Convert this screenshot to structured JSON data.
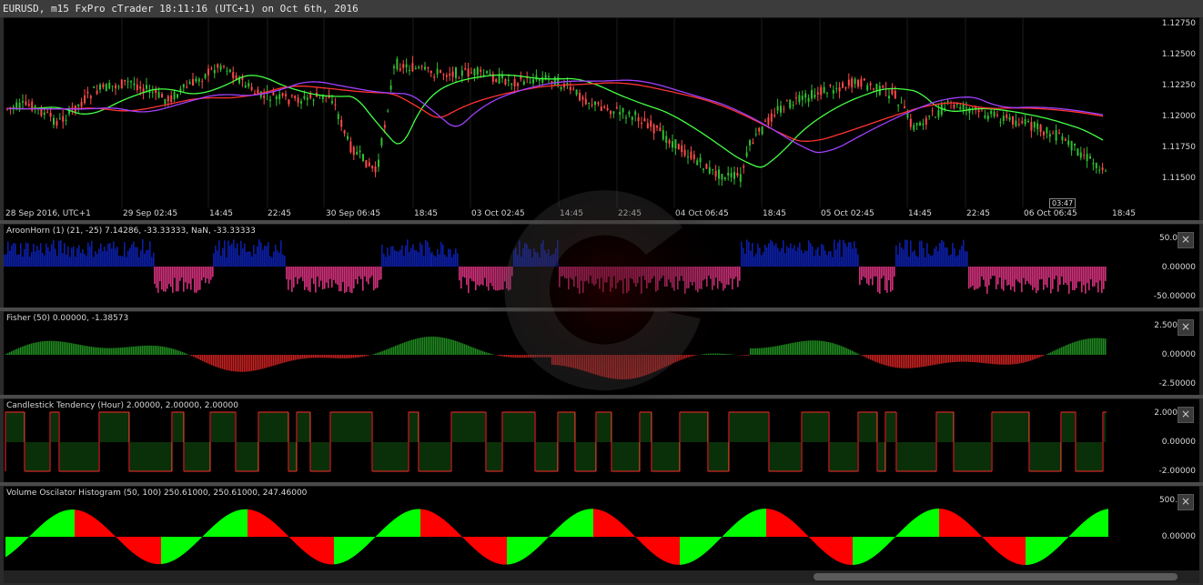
{
  "window": {
    "title": "EURUSD, m15 FxPro cTrader 18:11:16 (UTC+1) on Oct 6th, 2016"
  },
  "colors": {
    "bull": "#2fbf2f",
    "bear": "#ff4a4a",
    "blue_fill": "#0c1ea8",
    "pink_fill": "#d0307a",
    "fisher_green": "#1f8a1f",
    "fisher_red": "#c82020",
    "cst_green": "#1a7a1a",
    "cst_red": "#ff2a2a",
    "vo_green": "#00ff00",
    "vo_red": "#ff0000",
    "ma_green": "#44ff44",
    "ma_red": "#ff3333",
    "ma_purple": "#a040ff"
  },
  "price_pane": {
    "y_ticks": [
      "1.12750",
      "1.12500",
      "1.12250",
      "1.12000",
      "1.11750",
      "1.11500"
    ],
    "x_ticks": [
      "28 Sep 2016, UTC+1",
      "29 Sep 02:45",
      "14:45",
      "22:45",
      "30 Sep 06:45",
      "18:45",
      "03 Oct 02:45",
      "14:45",
      "22:45",
      "04 Oct 06:45",
      "18:45",
      "05 Oct 02:45",
      "14:45",
      "22:45",
      "06 Oct 06:45",
      "18:45"
    ],
    "time_badge": "03:47"
  },
  "panels": [
    {
      "id": "aroon",
      "label": "AroonHorn (1) (21, -25) 7.14286, -33.33333, NaN, -33.33333",
      "y_ticks": [
        "50.0",
        "0.00000",
        "-50.00000"
      ],
      "close_icon": "close-icon"
    },
    {
      "id": "fisher",
      "label": "Fisher (50) 0.00000, -1.38573",
      "y_ticks": [
        "2.500",
        "0.00000",
        "-2.50000"
      ],
      "close_icon": "close-icon"
    },
    {
      "id": "cst",
      "label": "Candlestick Tendency (Hour) 2.00000, 2.00000, 2.00000",
      "y_ticks": [
        "2.000",
        "0.00000",
        "-2.00000"
      ],
      "close_icon": "close-icon"
    },
    {
      "id": "vo",
      "label": "Volume Oscilator Histogram (50, 100) 250.61000, 250.61000, 247.46000",
      "y_ticks": [
        "500.",
        "0.00000"
      ],
      "close_icon": "close-icon"
    }
  ]
}
